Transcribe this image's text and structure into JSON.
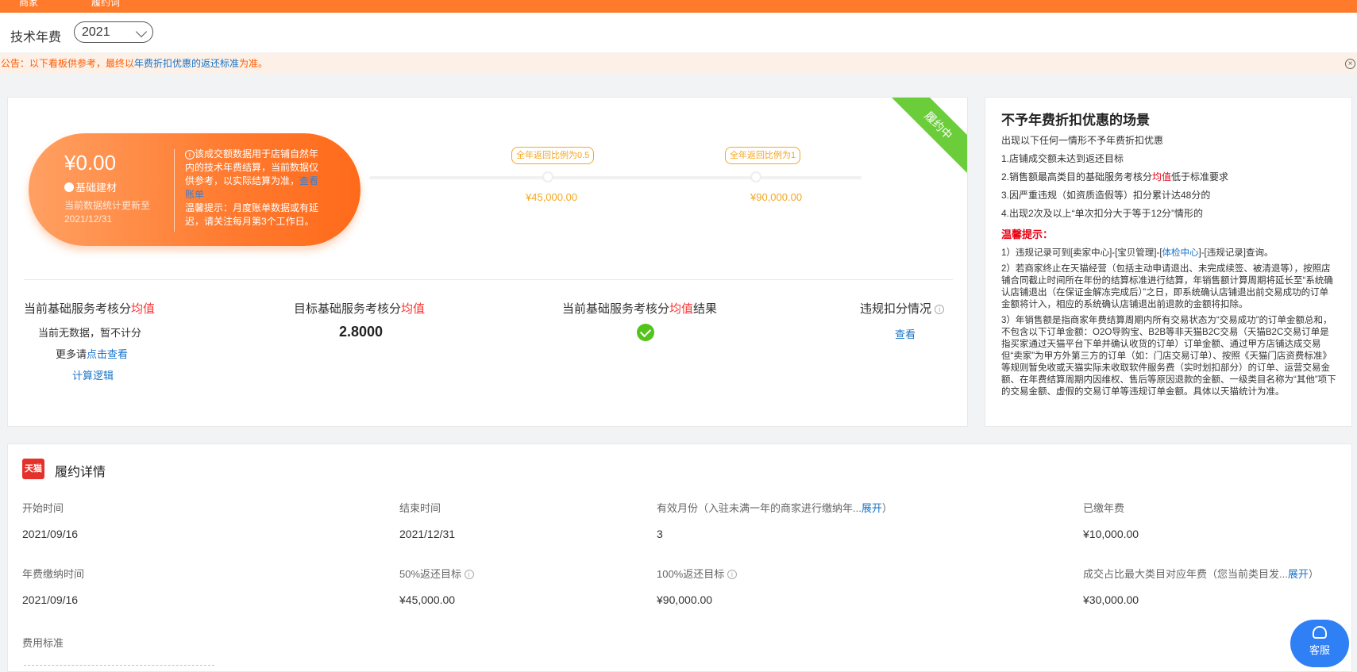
{
  "topbar": {
    "items": [
      "商家",
      "履约词"
    ]
  },
  "year_selector": {
    "label": "技术年费",
    "value": "2021"
  },
  "notice": {
    "prefix": "公告：以下看板供参考，最终以",
    "link": "年费折扣优惠的返还标准",
    "suffix": "为准。",
    "close": "×"
  },
  "summary": {
    "ribbon": "履约中",
    "amount": "¥0.00",
    "category": "基础建材",
    "update_note": "当前数据统计更新至2021/12/31",
    "info_icon": "i",
    "info_text": "该成交额数据用于店铺自然年内的技术年费结算，当前数据仅供参考，以实际结算为准，",
    "info_link": "查看账单",
    "tip": "温馨提示：月度账单数据或有延迟，请关注每月第3个工作日。",
    "milestones": [
      {
        "tag": "全年返回比例为0.5",
        "value": "¥45,000.00"
      },
      {
        "tag": "全年返回比例为1",
        "value": "¥90,000.00"
      }
    ]
  },
  "metrics": [
    {
      "title": "当前基础服务考核分",
      "highlight": "均值"
    },
    {
      "title": "目标基础服务考核分",
      "highlight": "均值"
    },
    {
      "title": "当前基础服务考核分",
      "highlight": "均值",
      "suffix": "结果"
    },
    {
      "title": "违规扣分情况"
    }
  ],
  "metric_values": {
    "no_data": "当前无数据，暂不计分",
    "more_prefix": "更多请",
    "more_link": "点击查看",
    "calc_logic": "计算逻辑",
    "target_score": "2.8000",
    "violation_link": "查看"
  },
  "side_panel": {
    "title": "不予年费折扣优惠的场景",
    "intro": "出现以下任何一情形不予年费折扣优惠",
    "items": [
      "1.店铺成交额未达到返还目标",
      "3.因严重违规（如资质造假等）扣分累计达48分的",
      "4.出现2次及以上“单次扣分大于等于12分”情形的"
    ],
    "item2_prefix": "2.销售额最高类目的基础服务考核分",
    "item2_highlight": "均值",
    "item2_suffix": "低于标准要求",
    "warn_title": "温馨提示：",
    "tip1_prefix": "1）违规记录可到[卖家中心]-[宝贝管理]-[",
    "tip1_link": "体检中心",
    "tip1_suffix": "]-[违规记录]查询。",
    "tip2": "2）若商家终止在天猫经营（包括主动申请退出、未完成续签、被清退等），按照店铺合同截止时间所在年份的结算标准进行结算，年销售额计算周期将延长至“系统确认店铺退出（在保证金解冻完成后）”之日，即系统确认店铺退出前交易成功的订单金额将计入，相应的系统确认店铺退出前退款的金额将扣除。",
    "tip3": "3）年销售额是指商家年费结算周期内所有交易状态为“交易成功”的订单金额总和，不包含以下订单金额：O2O导购宝、B2B等非天猫B2C交易（天猫B2C交易订单是指买家通过天猫平台下单并确认收货的订单）订单金额、通过甲方店铺达成交易但“卖家”为甲方外第三方的订单（如：门店交易订单）、按照《天猫门店资费标准》等规则暂免收或天猫实际未收取软件服务费（实时划扣部分）的订单、运营交易金额、在年费结算周期内因维权、售后等原因退款的金额、一级类目名称为“其他”项下的交易金额、虚假的交易订单等违规订单金额。具体以天猫统计为准。"
  },
  "details": {
    "logo": "天猫",
    "title": "履约详情",
    "start_label": "开始时间",
    "start_value": "2021/09/16",
    "end_label": "结束时间",
    "end_value": "2021/12/31",
    "months_label": "有效月份（入驻未满一年的商家进行缴纳年...",
    "months_expand": "展开",
    "months_close": "）",
    "months_value": "3",
    "paid_label": "已缴年费",
    "paid_value": "¥10,000.00",
    "paytime_label": "年费缴纳时间",
    "paytime_value": "2021/09/16",
    "target50_label": "50%返还目标",
    "target50_value": "¥45,000.00",
    "target100_label": "100%返还目标",
    "target100_value": "¥90,000.00",
    "maxcat_label": "成交占比最大类目对应年费（您当前类目发...",
    "maxcat_expand": "展开",
    "maxcat_close": "）",
    "maxcat_value": "¥30,000.00",
    "fee_std_label": "费用标准"
  },
  "service_button": {
    "label": "客服"
  }
}
